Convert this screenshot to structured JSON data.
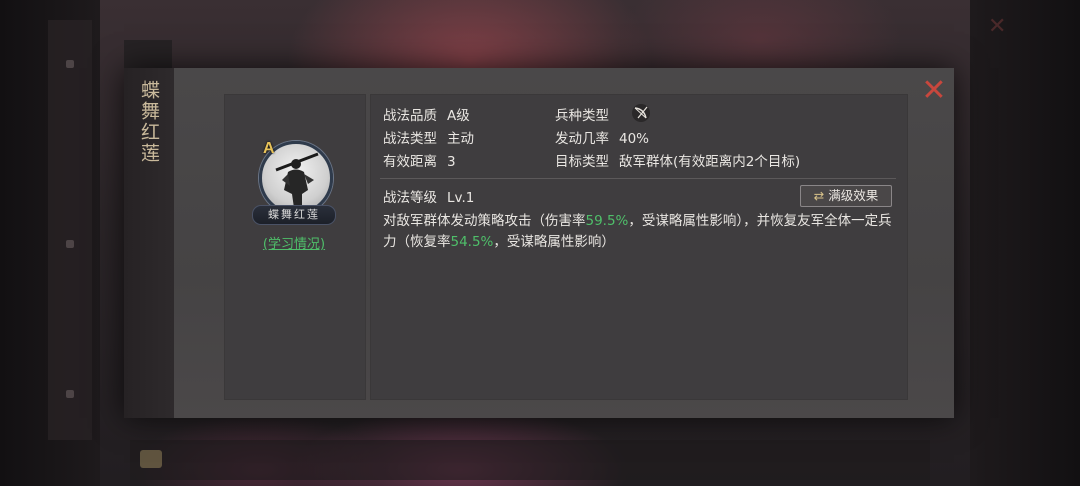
{
  "dialog": {
    "title": "蝶舞红莲",
    "close_icon": "close-x-icon"
  },
  "skill": {
    "grade_badge": "A",
    "name_plate": "蝶舞红莲",
    "learn_link": "(学习情况)",
    "icon": "warrior-portrait-icon"
  },
  "attributes": {
    "quality_label": "战法品质",
    "quality_value": "A级",
    "troop_label": "兵种类型",
    "troop_icon": "bow-troop-icon",
    "type_label": "战法类型",
    "type_value": "主动",
    "chance_label": "发动几率",
    "chance_value": "40%",
    "range_label": "有效距离",
    "range_value": "3",
    "target_label": "目标类型",
    "target_value": "敌军群体(有效距离内2个目标)"
  },
  "level": {
    "label": "战法等级",
    "value": "Lv.1",
    "max_button": "满级效果",
    "max_button_icon": "swap-arrows-icon"
  },
  "description": {
    "part1": "对敌军群体发动策略攻击（伤害率",
    "damage_rate": "59.5%",
    "part2": "，受谋略属性影响），并恢复友军全体一定兵力（恢复率",
    "heal_rate": "54.5%",
    "part3": "，受谋略属性影响）"
  },
  "colors": {
    "highlight": "#4fbf6a",
    "close": "#c8473d",
    "grade": "#e8c35a"
  }
}
